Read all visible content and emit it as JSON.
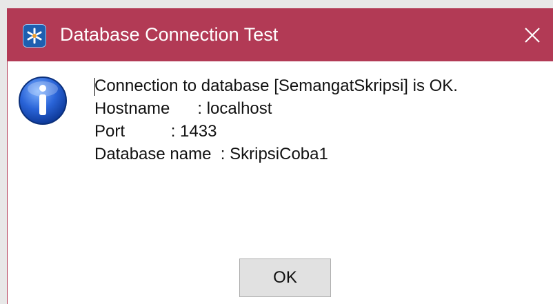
{
  "window": {
    "title": "Database Connection Test",
    "app_icon": "eclipse-star-icon",
    "close_icon": "close-icon",
    "titlebar_color": "#b23a55"
  },
  "message": {
    "icon": "info-icon",
    "lines": [
      "Connection to database [SemangatSkripsi] is OK.",
      "Hostname      : localhost",
      "Port          : 1433",
      "Database name  : SkripsiCoba1"
    ]
  },
  "buttons": {
    "ok_label": "OK"
  }
}
